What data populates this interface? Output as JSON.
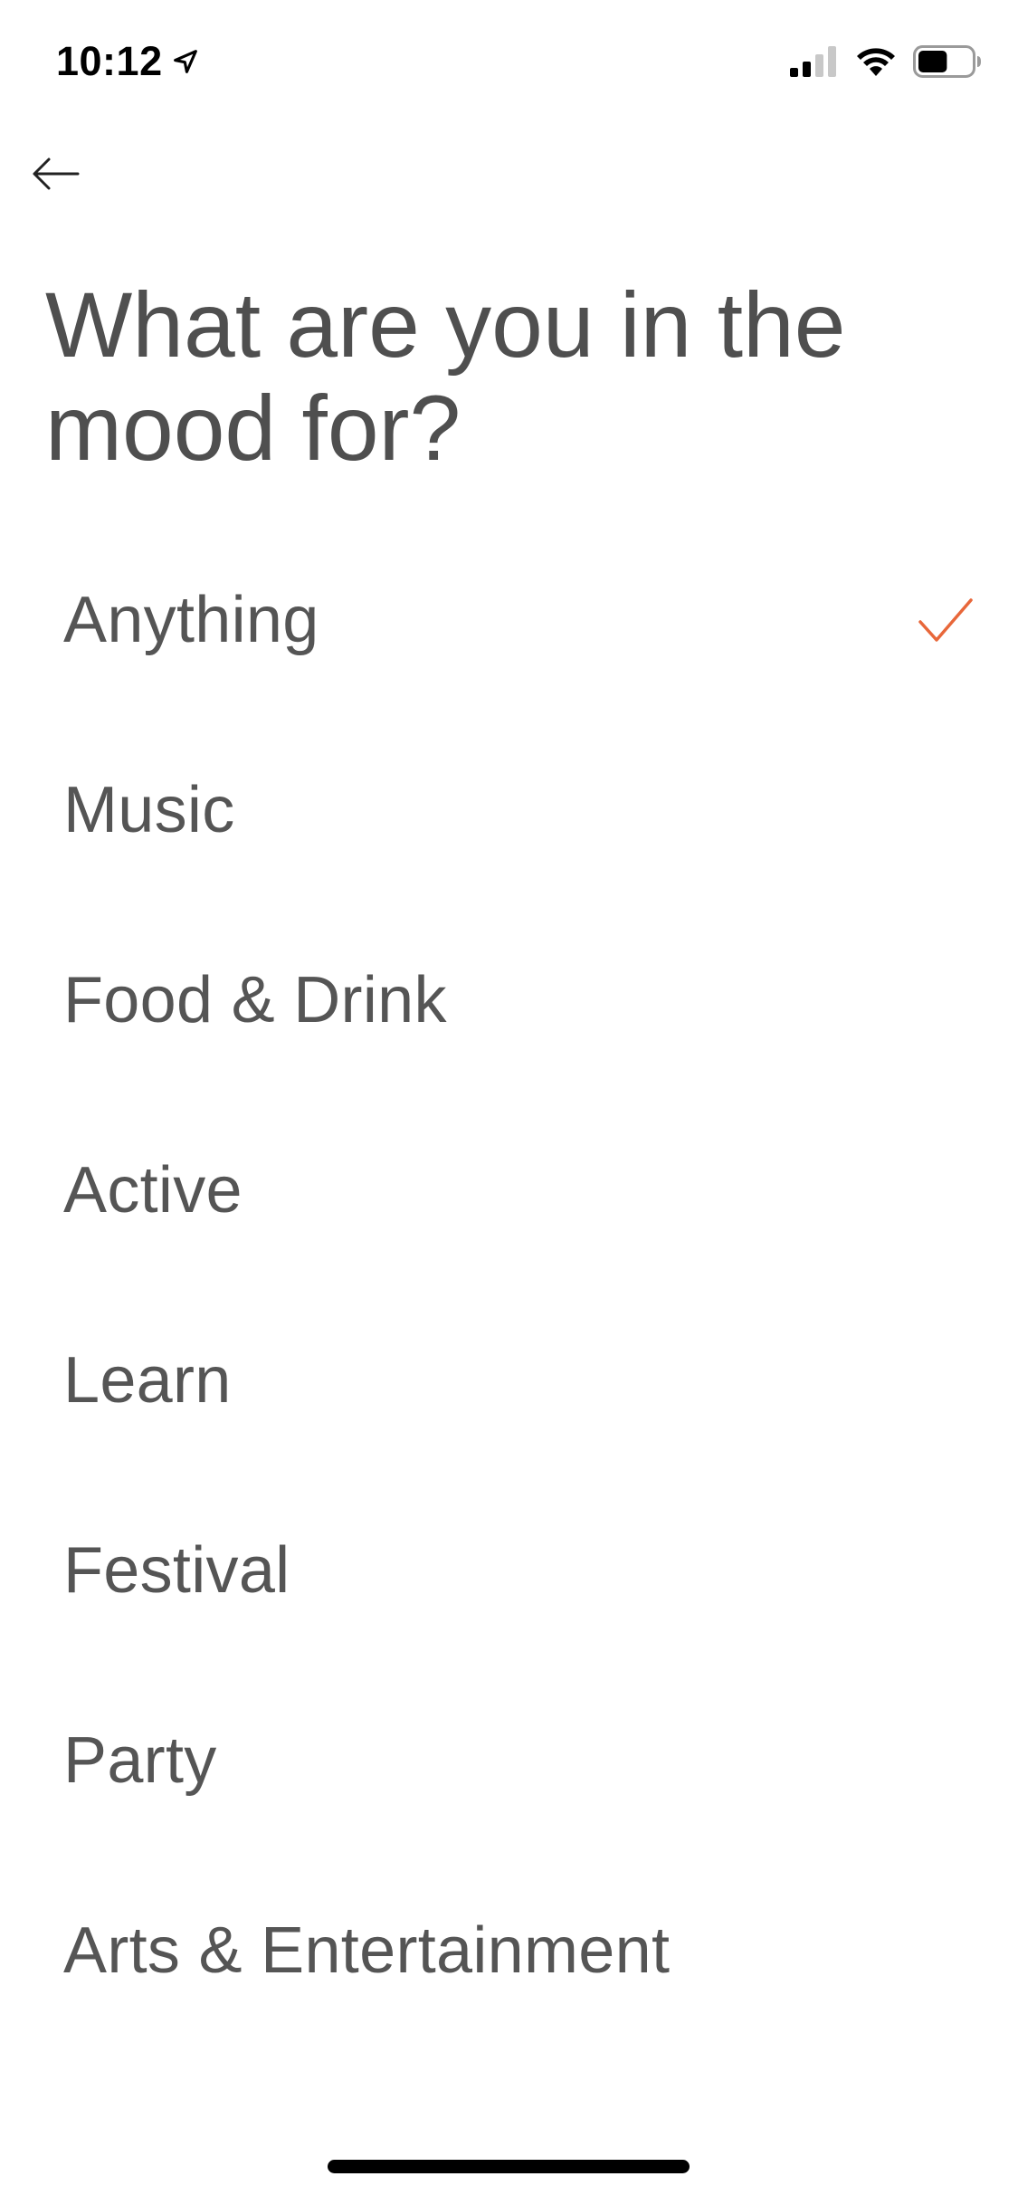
{
  "status_bar": {
    "time": "10:12",
    "location_icon": "location-arrow-icon",
    "signal_icon": "cellular-signal-icon",
    "wifi_icon": "wifi-icon",
    "battery_icon": "battery-icon",
    "battery_level": 0.55
  },
  "nav": {
    "back_icon": "arrow-left-icon"
  },
  "header": {
    "title": "What are you in the mood for?"
  },
  "moods": [
    {
      "label": "Anything",
      "selected": true
    },
    {
      "label": "Music",
      "selected": false
    },
    {
      "label": "Food & Drink",
      "selected": false
    },
    {
      "label": "Active",
      "selected": false
    },
    {
      "label": "Learn",
      "selected": false
    },
    {
      "label": "Festival",
      "selected": false
    },
    {
      "label": "Party",
      "selected": false
    },
    {
      "label": "Arts & Entertainment",
      "selected": false
    }
  ],
  "colors": {
    "accent": "#e8673a",
    "text": "#555555",
    "background": "#ffffff"
  }
}
